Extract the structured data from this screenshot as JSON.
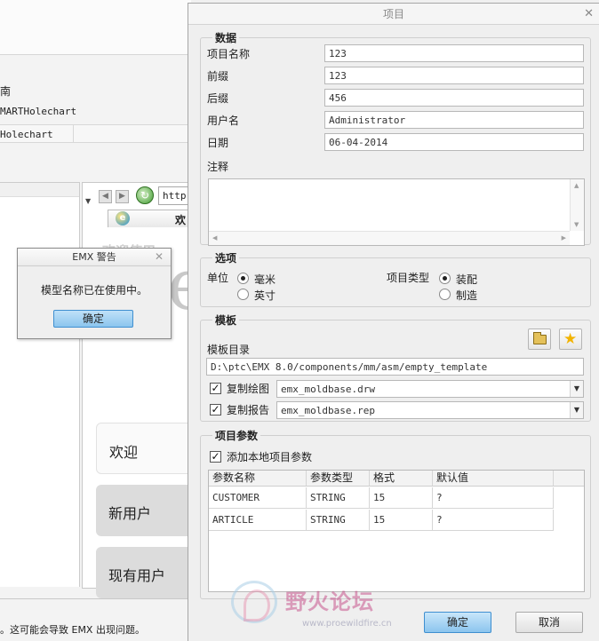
{
  "background_app": {
    "guide_partial": "南",
    "smart_holechart_partial": "MARTHolechart",
    "holechart_partial": "Holechart",
    "address_partial": "http",
    "tab_label_partial": "欢",
    "ghost_title_partial": "欢迎使用",
    "ghost_letter": "e",
    "cards": {
      "welcome": "欢迎",
      "new_user": "新用户",
      "current_user_partial": "现有用户"
    },
    "status_text": "。这可能会导致 EMX 出现问题。"
  },
  "warning_dialog": {
    "title": "EMX 警告",
    "message": "模型名称已在使用中。",
    "ok_label": "确定"
  },
  "dialog": {
    "title": "项目",
    "data_group": {
      "title": "数据",
      "fields": [
        {
          "label": "项目名称",
          "value": "123"
        },
        {
          "label": "前缀",
          "value": "123"
        },
        {
          "label": "后缀",
          "value": "456"
        },
        {
          "label": "用户名",
          "value": "Administrator"
        },
        {
          "label": "日期",
          "value": "06-04-2014"
        }
      ],
      "notes_label": "注释",
      "notes_value": ""
    },
    "options_group": {
      "title": "选项",
      "unit_label": "单位",
      "unit_options": [
        {
          "label": "毫米",
          "selected": true
        },
        {
          "label": "英寸",
          "selected": false
        }
      ],
      "project_type_label": "项目类型",
      "project_type_options": [
        {
          "label": "装配",
          "selected": true
        },
        {
          "label": "制造",
          "selected": false
        }
      ]
    },
    "template_group": {
      "title": "模板",
      "dir_label": "模板目录",
      "dir_value": "D:\\ptc\\EMX 8.0/components/mm/asm/empty_template",
      "copy_drawing_label": "复制绘图",
      "copy_drawing_checked": true,
      "copy_drawing_value": "emx_moldbase.drw",
      "copy_report_label": "复制报告",
      "copy_report_checked": true,
      "copy_report_value": "emx_moldbase.rep",
      "browse_icon": "folder-icon",
      "favorite_icon": "star-icon"
    },
    "params_group": {
      "title": "项目参数",
      "add_local_label": "添加本地项目参数",
      "add_local_checked": true,
      "columns": [
        "参数名称",
        "参数类型",
        "格式",
        "默认值"
      ],
      "rows": [
        [
          "CUSTOMER",
          "STRING",
          "15",
          "?"
        ],
        [
          "ARTICLE",
          "STRING",
          "15",
          "?"
        ]
      ]
    },
    "ok_label": "确定",
    "cancel_label": "取消"
  },
  "watermark": {
    "text": "野火论坛",
    "url_partial": "www.proewildfire.cn"
  },
  "colors": {
    "accent_button": "#8cc5ee",
    "accent_border": "#3f8fd0",
    "dialog_bg": "#efefef"
  }
}
